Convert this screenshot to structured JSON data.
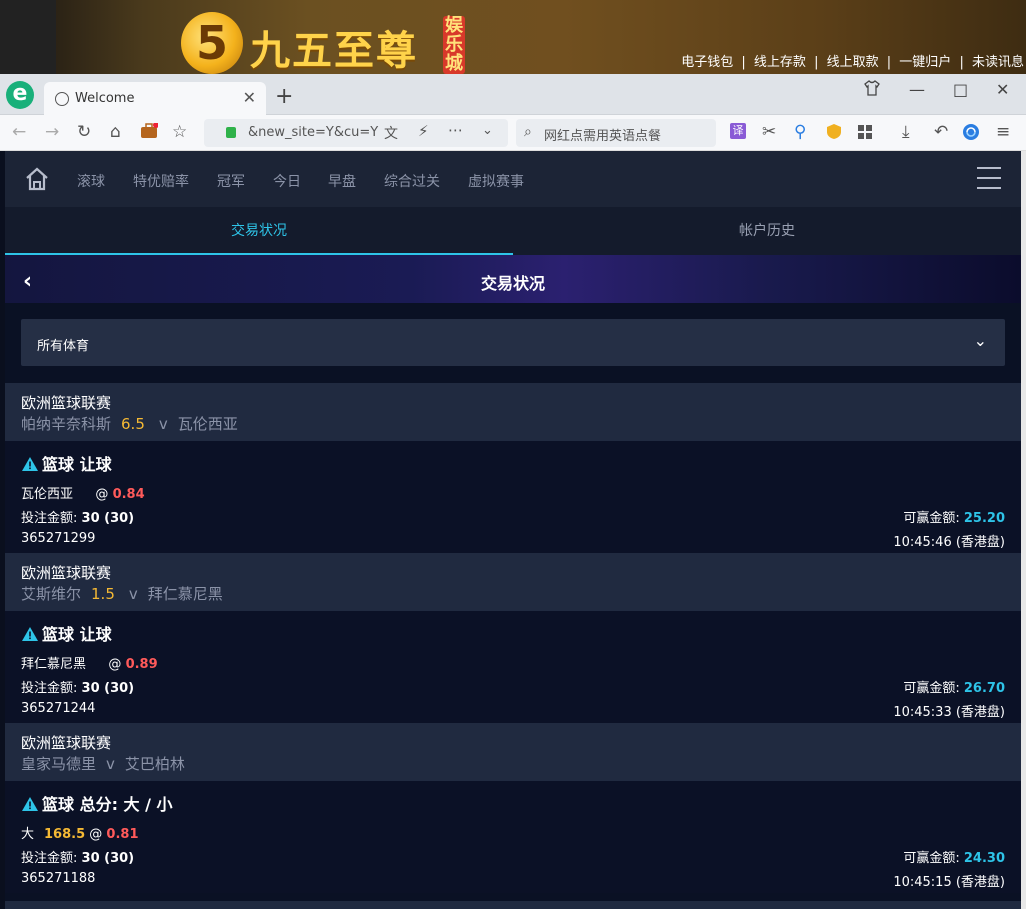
{
  "banner": {
    "logo_mark": "5",
    "logo_text": "九五至尊",
    "logo_badge": "娱乐城",
    "links": [
      "电子钱包",
      "线上存款",
      "线上取款",
      "一键归户",
      "未读讯息"
    ],
    "separator": "|"
  },
  "browser": {
    "logo": "e",
    "tab_title": "Welcome",
    "url": "&new_site=Y&cu=Y",
    "search_text": "网红点需用英语点餐",
    "translate_icon": "译",
    "window_controls": [
      "—",
      "□",
      "✕"
    ]
  },
  "nav": {
    "items": [
      "滚球",
      "特优赔率",
      "冠军",
      "今日",
      "早盘",
      "综合过关",
      "虚拟赛事"
    ]
  },
  "subtabs": {
    "active": "交易状况",
    "inactive": "帐户历史"
  },
  "title": "交易状况",
  "filter": {
    "label": "所有体育"
  },
  "bets": [
    {
      "league": "欧洲篮球联赛",
      "home": "帕纳辛奈科斯",
      "handicap": "6.5",
      "vs": "v",
      "away": "瓦伦西亚",
      "type": "篮球 让球",
      "selection": "瓦伦西亚",
      "selection_value": "",
      "at": "@",
      "odds": "0.84",
      "stake_label": "投注金额:",
      "stake": "30 (30)",
      "win_label": "可赢金额:",
      "win": "25.20",
      "ref": "365271299",
      "time": "10:45:46 (香港盘)"
    },
    {
      "league": "欧洲篮球联赛",
      "home": "艾斯维尔",
      "handicap": "1.5",
      "vs": "v",
      "away": "拜仁慕尼黑",
      "type": "篮球 让球",
      "selection": "拜仁慕尼黑",
      "selection_value": "",
      "at": "@",
      "odds": "0.89",
      "stake_label": "投注金额:",
      "stake": "30 (30)",
      "win_label": "可赢金额:",
      "win": "26.70",
      "ref": "365271244",
      "time": "10:45:33 (香港盘)"
    },
    {
      "league": "欧洲篮球联赛",
      "home": "皇家马德里",
      "handicap": "",
      "vs": "v",
      "away": "艾巴柏林",
      "type": "篮球 总分: 大 / 小",
      "selection": "大",
      "selection_value": "168.5",
      "at": "@",
      "odds": "0.81",
      "stake_label": "投注金额:",
      "stake": "30 (30)",
      "win_label": "可赢金额:",
      "win": "24.30",
      "ref": "365271188",
      "time": "10:45:15 (香港盘)"
    }
  ]
}
